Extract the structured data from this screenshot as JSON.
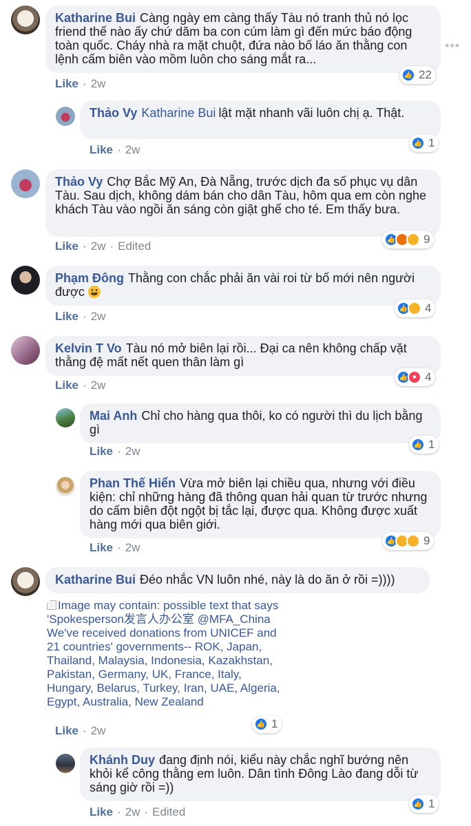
{
  "more_icon": "more-dots-icon",
  "colors": {
    "author": "#385898",
    "bubble": "#f0f2f5",
    "meta": "#7f8690",
    "like_reaction": "#1877f2"
  },
  "comments": [
    {
      "author": "Katharine Bui",
      "text": "Càng ngày em càng thấy Tàu nó tranh thủ nó lọc friend thế nào ấy chứ dăm ba con cúm làm gì đến mức báo động toàn quốc. Cháy nhà ra mặt chuột, đứa nào bố láo ăn thằng con lệnh cấm biên vào mồm luôn cho sáng mắt ra...",
      "like": "Like",
      "time": "2w",
      "reaction_count": "22",
      "reactions": [
        "like"
      ]
    },
    {
      "author": "Thảo Vy",
      "mention": "Katharine Bui",
      "text": "lật mặt nhanh vãi luôn chị ạ. Thật.",
      "like": "Like",
      "time": "2w",
      "reaction_count": "1",
      "reactions": [
        "like"
      ]
    },
    {
      "author": "Thảo Vy",
      "text": "Chợ Bắc Mỹ An, Đà Nẵng, trước dịch đa số phục vụ dân Tàu. Sau dịch, không dám bán cho dân Tàu, hôm qua em còn nghe khách Tàu vào ngồi ăn sáng còn giật ghế cho té. Em thấy bưa.",
      "like": "Like",
      "time": "2w",
      "edited": "Edited",
      "reaction_count": "9",
      "reactions": [
        "like",
        "angry",
        "sad"
      ]
    },
    {
      "author": "Phạm Đông",
      "text": "Thằng con chắc phải ăn vài roi từ bố mới nên người được",
      "like": "Like",
      "time": "2w",
      "reaction_count": "4",
      "reactions": [
        "like",
        "haha"
      ]
    },
    {
      "author": "Kelvin T Vo",
      "text": "Tàu nó mở biên lại rồi... Đại ca nên không chấp vặt thằng đệ mất nết quen thân làm gì",
      "like": "Like",
      "time": "2w",
      "reaction_count": "4",
      "reactions": [
        "like",
        "love"
      ]
    },
    {
      "author": "Mai Anh",
      "text": "Chỉ cho hàng qua thôi, ko có người thì du lịch bằng gì",
      "like": "Like",
      "time": "2w",
      "reaction_count": "1",
      "reactions": [
        "like"
      ]
    },
    {
      "author": "Phan Thế Hiển",
      "text": "Vừa mở biên lại chiều qua, nhưng với điều kiện: chỉ những hàng đã thông quan hải quan từ trước nhưng do cấm biên đột ngột bị tắc lại, được qua. Không được xuất hàng mới qua biên giới.",
      "like": "Like",
      "time": "2w",
      "reaction_count": "9",
      "reactions": [
        "like",
        "wow",
        "sad"
      ]
    },
    {
      "author": "Katharine Bui",
      "text": "Đéo nhắc VN luôn nhé, này là do ăn ở rồi =))))",
      "image_alt": "Image may contain: possible text that says 'Spokesperson发言人办公室 @MFA_China We've received donations from UNICEF and 21 countries' governments-- ROK, Japan, Thailand, Malaysia, Indonesia, Kazakhstan, Pakistan, Germany, UK, France, Italy, Hungary, Belarus, Turkey, Iran, UAE, Algeria, Egypt, Australia, New Zealand",
      "like": "Like",
      "time": "2w",
      "reaction_count": "1",
      "reactions": [
        "like"
      ]
    },
    {
      "author": "Khánh Duy",
      "text": "đang định nói, kiểu này chắc nghĩ bướng nên khỏi kể công thằng em luôn. Dân tình Đông Lào đang dỗi từ sáng giờ rồi =))",
      "like": "Like",
      "time": "2w",
      "edited": "Edited",
      "reaction_count": "1",
      "reactions": [
        "like"
      ]
    }
  ]
}
